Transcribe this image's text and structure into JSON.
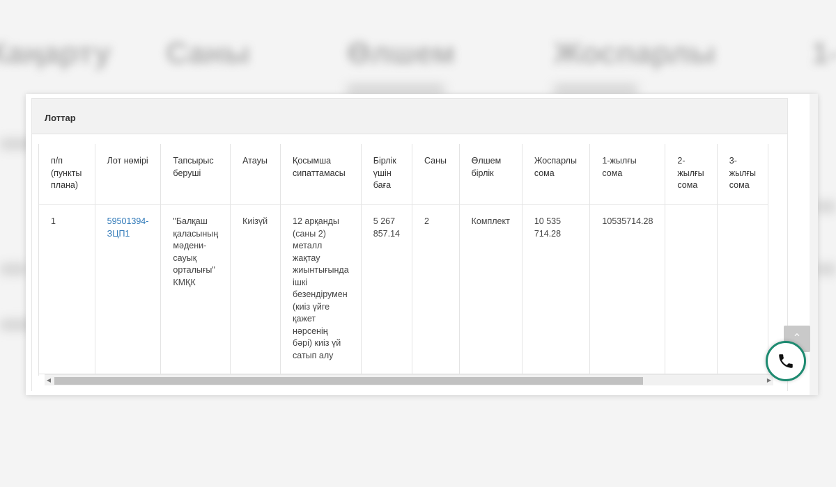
{
  "background": {
    "words": [
      "Жаңарту",
      "Саны",
      "Өлшем",
      "Жоспарлы",
      "1-"
    ]
  },
  "panel": {
    "heading": "Лоттар"
  },
  "table": {
    "headers": [
      "п/п (пункты плана)",
      "Лот нөмірі",
      "Тапсырыс беруші",
      "Атауы",
      "Қосымша сипаттамасы",
      "Бірлік үшін баға",
      "Саны",
      "Өлшем бірлік",
      "Жоспарлы сома",
      "1-жылғы сома",
      "2-жылғы сома",
      "3-жылғы сома"
    ],
    "rows": [
      {
        "num": "1",
        "lot_number": "59501394-ЗЦП1",
        "customer": "\"Балқаш қаласының мәдени-сауық орталығы\" КМҚК",
        "name": "Киізүй",
        "description": "12 арқанды (саны 2) металл жақтау жиынтығында ішкі безендірумен (киіз үйге қажет нәрсенің бәрі) киіз үй сатып алу",
        "unit_price": "5 267 857.14",
        "quantity": "2",
        "unit": "Комплект",
        "planned_sum": "10 535 714.28",
        "year1_sum": "10535714.28",
        "year2_sum": "",
        "year3_sum": ""
      }
    ]
  },
  "icons": {
    "scroll_top": "chevron-up-icon",
    "call": "phone-icon",
    "scroll_left": "triangle-left-icon",
    "scroll_right": "triangle-right-icon"
  },
  "colors": {
    "link": "#2e78b8",
    "call_ring": "#1d8a70"
  }
}
